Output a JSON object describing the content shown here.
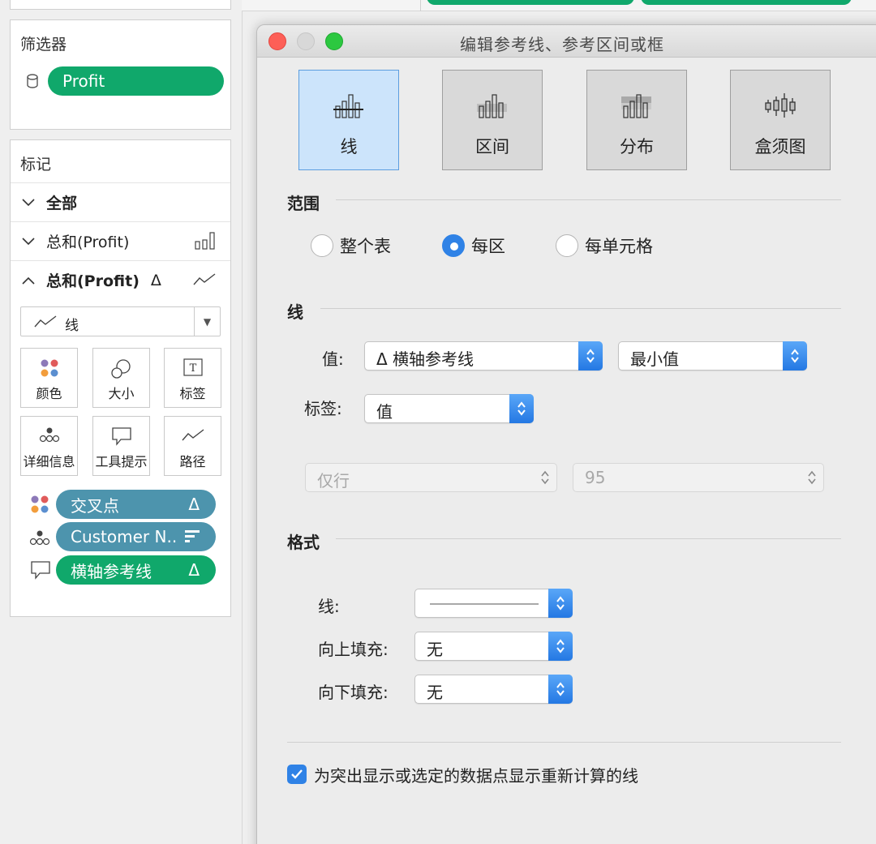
{
  "filters": {
    "title": "筛选器",
    "pill_label": "Profit"
  },
  "marks": {
    "title": "标记",
    "rows": [
      {
        "label": "全部"
      },
      {
        "label": "总和(Profit)"
      },
      {
        "label": "总和(Profit)",
        "delta": "Δ"
      }
    ],
    "mark_type": "线",
    "buttons": [
      {
        "label": "颜色"
      },
      {
        "label": "大小"
      },
      {
        "label": "标签"
      },
      {
        "label": "详细信息"
      },
      {
        "label": "工具提示"
      },
      {
        "label": "路径"
      }
    ],
    "fields": [
      {
        "label": "交叉点",
        "suffix": "Δ"
      },
      {
        "label": "Customer N..",
        "suffix": ""
      },
      {
        "label": "横轴参考线",
        "suffix": "Δ"
      }
    ]
  },
  "dialog": {
    "title": "编辑参考线、参考区间或框",
    "tabs": [
      {
        "label": "线",
        "active": true
      },
      {
        "label": "区间",
        "active": false
      },
      {
        "label": "分布",
        "active": false
      },
      {
        "label": "盒须图",
        "active": false
      }
    ],
    "scope": {
      "label": "范围",
      "options": [
        {
          "label": "整个表",
          "selected": false
        },
        {
          "label": "每区",
          "selected": true
        },
        {
          "label": "每单元格",
          "selected": false
        }
      ]
    },
    "line": {
      "label": "线",
      "value_label": "值:",
      "value_field": "Δ 横轴参考线",
      "aggregation": "最小值",
      "label_label": "标签:",
      "label_value": "值",
      "disabled_left": "仅行",
      "disabled_right": "95"
    },
    "format": {
      "label": "格式",
      "line_label": "线:",
      "fill_above_label": "向上填充:",
      "fill_above_value": "无",
      "fill_below_label": "向下填充:",
      "fill_below_value": "无"
    },
    "recalc_checkbox": {
      "label": "为突出显示或选定的数据点显示重新计算的线",
      "checked": true
    }
  },
  "colors": {
    "green_pill": "#10a86b",
    "teal_pill": "#4d94ad",
    "accent_blue": "#2f82e6",
    "close_red": "#fd5f57",
    "zoom_green": "#2cc840"
  }
}
